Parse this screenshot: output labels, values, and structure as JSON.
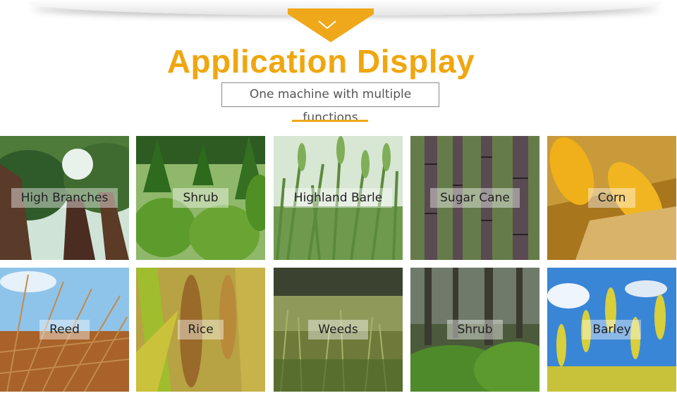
{
  "banner": {
    "chevron_icon": "chevron-down-icon",
    "accent": "#efa81a"
  },
  "heading": {
    "title": "Application Display",
    "subtitle": "One machine with multiple functions"
  },
  "tiles": [
    {
      "label": "High Branches"
    },
    {
      "label": "Shrub"
    },
    {
      "label": "Highland Barle"
    },
    {
      "label": "Sugar Cane"
    },
    {
      "label": "Corn"
    },
    {
      "label": "Reed"
    },
    {
      "label": "Rice"
    },
    {
      "label": "Weeds"
    },
    {
      "label": "Shrub"
    },
    {
      "label": "Barley"
    }
  ]
}
